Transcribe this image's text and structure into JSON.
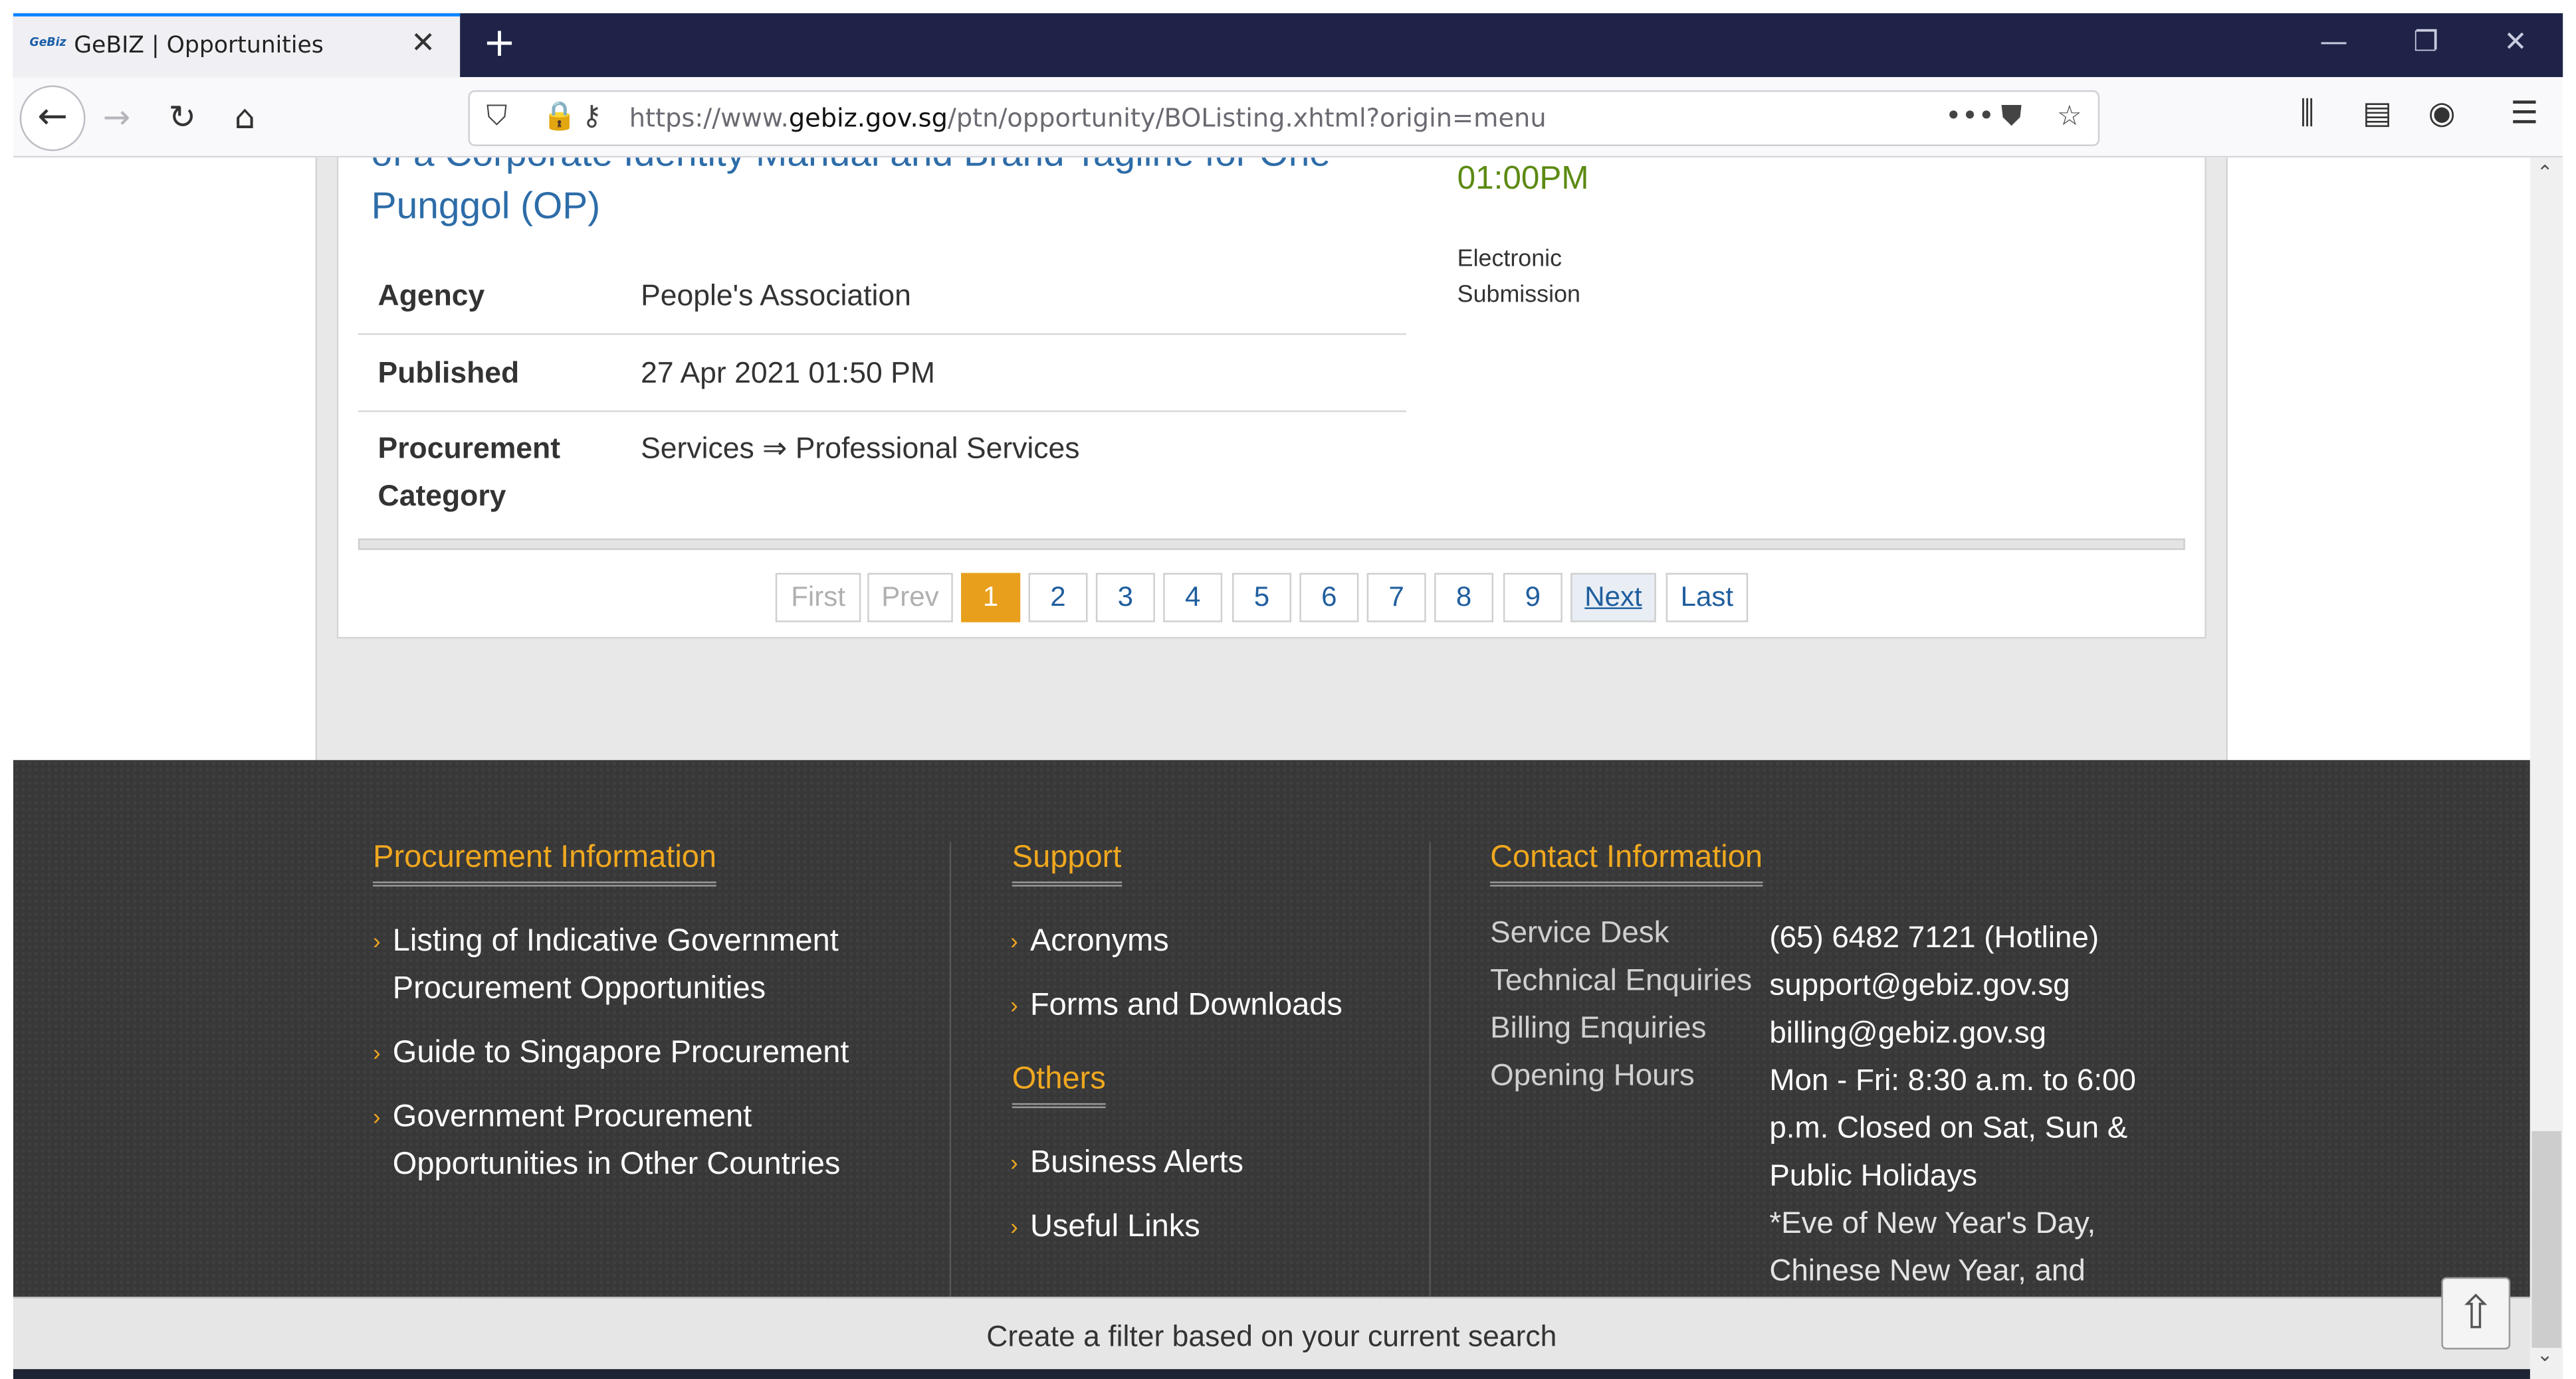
{
  "browser": {
    "tab_title": "GeBIZ | Opportunities",
    "favicon_text": "GeBiz",
    "url_prefix": "https://www.",
    "url_domain": "gebiz.gov.sg",
    "url_path": "/ptn/opportunity/BOListing.xhtml?origin=menu"
  },
  "opportunity": {
    "title": "of a Corporate Identity Manual and Brand Tagline for One Punggol (OP)",
    "closing_time": "01:00PM",
    "submission_method": "Electronic Submission",
    "fields": [
      {
        "label": "Agency",
        "value": "People's Association"
      },
      {
        "label": "Published",
        "value": "27 Apr 2021 01:50 PM"
      },
      {
        "label": "Procurement Category",
        "value": "Services ⇒ Professional Services"
      }
    ]
  },
  "pagination": {
    "first": "First",
    "prev": "Prev",
    "pages": [
      "1",
      "2",
      "3",
      "4",
      "5",
      "6",
      "7",
      "8",
      "9"
    ],
    "current": "1",
    "next": "Next",
    "last": "Last"
  },
  "footer": {
    "procurement_heading": "Procurement Information",
    "procurement_links": [
      "Listing of Indicative Government Procurement Opportunities",
      "Guide to Singapore Procurement",
      "Government Procurement Opportunities in Other Countries"
    ],
    "support_heading": "Support",
    "support_links": [
      "Acronyms",
      "Forms and Downloads"
    ],
    "others_heading": "Others",
    "others_links": [
      "Business Alerts",
      "Useful Links"
    ],
    "contact_heading": "Contact Information",
    "contact": {
      "service_desk_label": "Service Desk",
      "service_desk_value": "(65) 6482 7121 (Hotline)",
      "technical_label": "Technical Enquiries",
      "technical_value": "support@gebiz.gov.sg",
      "billing_label": "Billing Enquiries",
      "billing_value": "billing@gebiz.gov.sg",
      "hours_label": "Opening Hours",
      "hours_value": "Mon - Fri: 8:30 a.m. to 6:00 p.m. Closed on Sat, Sun & Public Holidays",
      "hours_note": "*Eve of New Year's Day, Chinese New Year, and Christmas Day:"
    }
  },
  "filter_bar": {
    "label": "Create a filter based on your current search"
  },
  "colors": {
    "accent_orange": "#e8a01c",
    "link_blue": "#2d6ca8",
    "footer_bg": "#383838",
    "tabbar_bg": "#1f2347"
  }
}
